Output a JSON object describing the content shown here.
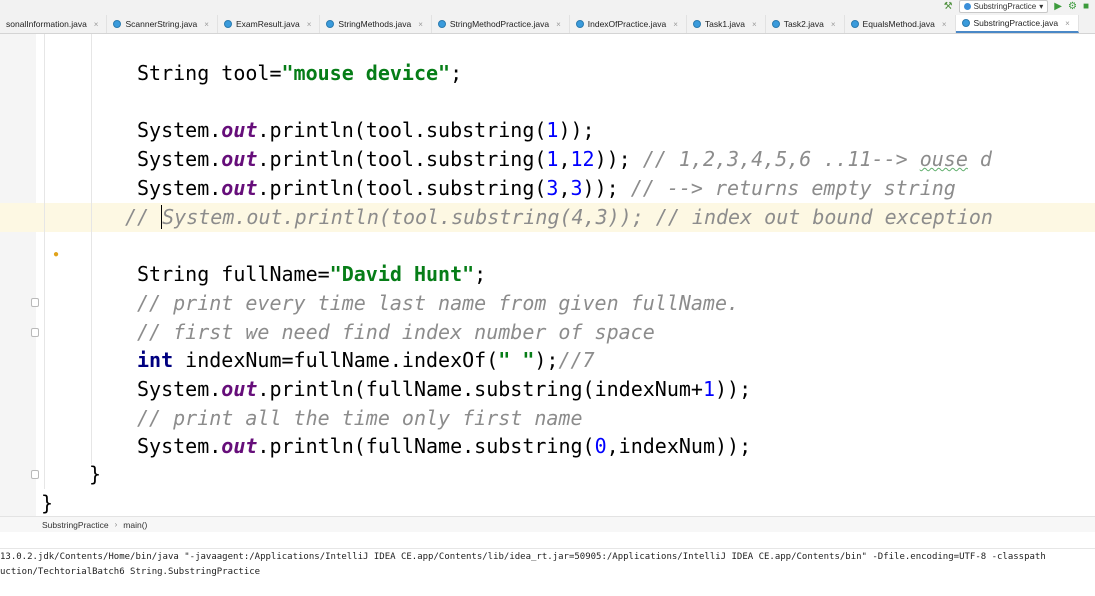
{
  "toolbar": {
    "run_config": "SubstringPractice",
    "dropdown_arrow": "▾"
  },
  "tabs": [
    {
      "label": "sonalInformation.java",
      "active": false
    },
    {
      "label": "ScannerString.java",
      "active": false
    },
    {
      "label": "ExamResult.java",
      "active": false
    },
    {
      "label": "StringMethods.java",
      "active": false
    },
    {
      "label": "StringMethodPractice.java",
      "active": false
    },
    {
      "label": "IndexOfPractice.java",
      "active": false
    },
    {
      "label": "Task1.java",
      "active": false
    },
    {
      "label": "Task2.java",
      "active": false
    },
    {
      "label": "EqualsMethod.java",
      "active": false
    },
    {
      "label": "SubstringPractice.java",
      "active": true
    }
  ],
  "tab_close": "×",
  "code": {
    "l1_kw": "String tool=",
    "l1_str": "\"mouse device\"",
    "l1_end": ";",
    "l2_a": "System.",
    "l2_out": "out",
    "l2_b": ".println(tool.substring(",
    "l2_n1": "1",
    "l2_c": "));",
    "l3_a": "System.",
    "l3_out": "out",
    "l3_b": ".println(tool.substring(",
    "l3_n1": "1",
    "l3_comma": ",",
    "l3_n2": "12",
    "l3_c": ")); ",
    "l3_cmt": "// 1,2,3,4,5,6 ..11--> ",
    "l3_cmt2": "ouse",
    "l3_cmt3": " d",
    "l4_a": "System.",
    "l4_out": "out",
    "l4_b": ".println(tool.substring(",
    "l4_n1": "3",
    "l4_comma": ",",
    "l4_n2": "3",
    "l4_c": ")); ",
    "l4_cmt": "// --> returns empty string",
    "l5_cmt_a": "// ",
    "l5_cmt_b": "System.out.println(tool.substring(4,3)); // index out bound exception",
    "l6_kw": "String fullName=",
    "l6_str": "\"David Hunt\"",
    "l6_end": ";",
    "l7_cmt": "// print every time last name from given fullName.",
    "l8_cmt": "// first we need find index number of space",
    "l9_int": "int",
    "l9_a": " indexNum=fullName.indexOf(",
    "l9_str": "\" \"",
    "l9_b": ");",
    "l9_cmt": "//7",
    "l10_a": "System.",
    "l10_out": "out",
    "l10_b": ".println(fullName.substring(indexNum+",
    "l10_n": "1",
    "l10_c": "));",
    "l11_cmt": "// print all the time only first name",
    "l12_a": "System.",
    "l12_out": "out",
    "l12_b": ".println(fullName.substring(",
    "l12_n": "0",
    "l12_c": ",indexNum));",
    "l13": "}",
    "l14": "}"
  },
  "breadcrumb": {
    "class": "SubstringPractice",
    "method": "main()",
    "sep": "›"
  },
  "console": {
    "line1": "13.0.2.jdk/Contents/Home/bin/java \"-javaagent:/Applications/IntelliJ IDEA CE.app/Contents/lib/idea_rt.jar=50905:/Applications/IntelliJ IDEA CE.app/Contents/bin\" -Dfile.encoding=UTF-8 -classpath",
    "line2": "uction/TechtorialBatch6 String.SubstringPractice"
  },
  "icons": [
    "hammer-icon",
    "run-icon",
    "debug-icon",
    "more-icon",
    "java-class-icon",
    "lightbulb-icon"
  ],
  "colors": {
    "keyword": "#000080",
    "field": "#660e7a",
    "string": "#067d17",
    "number": "#0000ff",
    "comment": "#8c8c8c",
    "caret_row": "#fdf8e3",
    "active_tab": "#4a88c7"
  }
}
